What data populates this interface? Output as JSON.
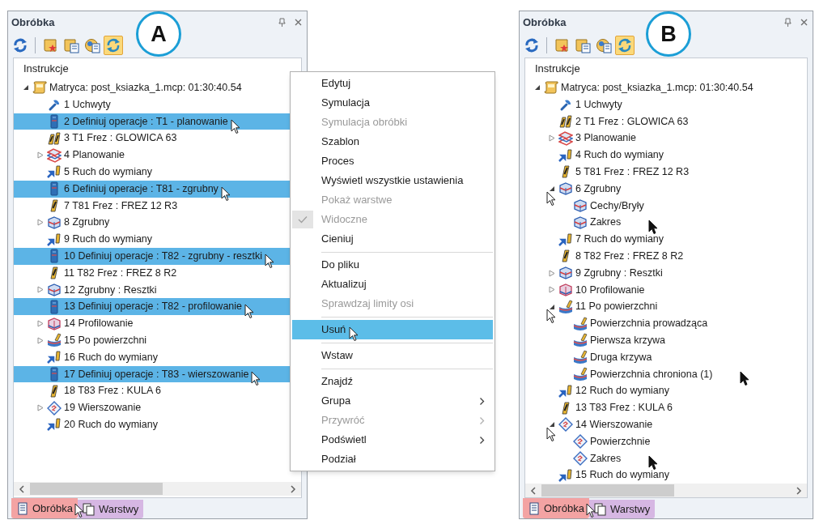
{
  "panels": [
    {
      "annotation": "A",
      "title": "Obróbka",
      "toolbar": [
        {
          "kind": "refresh",
          "selected": false
        },
        {
          "kind": "separator"
        },
        {
          "kind": "scrollstar",
          "selected": false
        },
        {
          "kind": "scrolldoc",
          "selected": false
        },
        {
          "kind": "discdoc",
          "selected": false
        },
        {
          "kind": "sync",
          "selected": true
        }
      ],
      "tree_header": "Instrukcje",
      "tree": [
        {
          "label": "Matryca: post_ksiazka_1.mcp: 01:30:40.54",
          "kind": "nc",
          "expanded": true,
          "selected": false,
          "children": [
            {
              "label": "1 Uchwyty",
              "kind": "fixture",
              "selected": false
            },
            {
              "label": "2 Definiuj operacje : T1 - planowanie",
              "kind": "define",
              "selected": true
            },
            {
              "label": "3 T1 Frez : GLOWICA 63",
              "kind": "facemill",
              "selected": false
            },
            {
              "label": "4 Planowanie",
              "kind": "planar",
              "expanded": false,
              "selected": false
            },
            {
              "label": "5 Ruch do wymiany",
              "kind": "move",
              "selected": false
            },
            {
              "label": "6 Definiuj operacje : T81 - zgrubny",
              "kind": "define",
              "selected": true
            },
            {
              "label": "7 T81 Frez : FREZ 12 R3",
              "kind": "tool",
              "selected": false
            },
            {
              "label": "8 Zgrubny",
              "kind": "rough",
              "expanded": false,
              "selected": false
            },
            {
              "label": "9 Ruch do wymiany",
              "kind": "move",
              "selected": false
            },
            {
              "label": "10 Definiuj operacje : T82 - zgrubny - resztki",
              "kind": "define",
              "selected": true
            },
            {
              "label": "11 T82 Frez : FREZ 8 R2",
              "kind": "tool",
              "selected": false
            },
            {
              "label": "12 Zgrubny : Resztki",
              "kind": "rough",
              "expanded": false,
              "selected": false
            },
            {
              "label": "13 Definiuj operacje : T82 - profilowanie",
              "kind": "define",
              "selected": true
            },
            {
              "label": "14 Profilowanie",
              "kind": "profile",
              "expanded": false,
              "selected": false
            },
            {
              "label": "15 Po powierzchni",
              "kind": "surface",
              "expanded": false,
              "selected": false
            },
            {
              "label": "16 Ruch do wymiany",
              "kind": "move",
              "selected": false
            },
            {
              "label": "17 Definiuj operacje : T83 - wierszowanie",
              "kind": "define",
              "selected": true
            },
            {
              "label": "18 T83 Frez : KULA 6",
              "kind": "tool",
              "selected": false
            },
            {
              "label": "19 Wierszowanie",
              "kind": "raster",
              "expanded": false,
              "selected": false
            },
            {
              "label": "20 Ruch do wymiany",
              "kind": "move",
              "selected": false
            }
          ]
        }
      ],
      "bottom_tabs": [
        {
          "label": "Obróbka",
          "kind": "document",
          "selected": true,
          "color": "#f3a3a3"
        },
        {
          "label": "Warstwy",
          "kind": "layers",
          "selected": false,
          "color": "#d6b7e3"
        }
      ]
    },
    {
      "annotation": "B",
      "title": "Obróbka",
      "toolbar": [
        {
          "kind": "refresh",
          "selected": false
        },
        {
          "kind": "separator"
        },
        {
          "kind": "scrollstar",
          "selected": false
        },
        {
          "kind": "scrolldoc",
          "selected": false
        },
        {
          "kind": "discdoc",
          "selected": false
        },
        {
          "kind": "sync",
          "selected": true
        }
      ],
      "tree_header": "Instrukcje",
      "tree": [
        {
          "label": "Matryca: post_ksiazka_1.mcp: 01:30:40.54",
          "kind": "nc",
          "expanded": true,
          "selected": false,
          "children": [
            {
              "label": "1 Uchwyty",
              "kind": "fixture",
              "selected": false
            },
            {
              "label": "2 T1 Frez : GLOWICA 63",
              "kind": "facemill",
              "selected": false
            },
            {
              "label": "3 Planowanie",
              "kind": "planar",
              "expanded": false,
              "selected": false
            },
            {
              "label": "4 Ruch do wymiany",
              "kind": "move",
              "selected": false
            },
            {
              "label": "5 T81 Frez : FREZ 12 R3",
              "kind": "tool",
              "selected": false
            },
            {
              "label": "6 Zgrubny",
              "kind": "rough",
              "expanded": true,
              "selected": false,
              "children": [
                {
                  "label": "Cechy/Bryły",
                  "kind": "rough",
                  "selected": false
                },
                {
                  "label": "Zakres",
                  "kind": "rough",
                  "selected": false
                }
              ]
            },
            {
              "label": "7 Ruch do wymiany",
              "kind": "move",
              "selected": false
            },
            {
              "label": "8 T82 Frez : FREZ 8 R2",
              "kind": "tool",
              "selected": false
            },
            {
              "label": "9 Zgrubny : Resztki",
              "kind": "rough",
              "expanded": false,
              "selected": false
            },
            {
              "label": "10 Profilowanie",
              "kind": "profile",
              "expanded": false,
              "selected": false
            },
            {
              "label": "11 Po powierzchni",
              "kind": "surface",
              "expanded": true,
              "selected": false,
              "children": [
                {
                  "label": "Powierzchnia prowadząca",
                  "kind": "surface",
                  "selected": false
                },
                {
                  "label": "Pierwsza krzywa",
                  "kind": "surface",
                  "selected": false
                },
                {
                  "label": "Druga krzywa",
                  "kind": "surface",
                  "selected": false
                },
                {
                  "label": "Powierzchnia chroniona (1)",
                  "kind": "surface",
                  "selected": false
                }
              ]
            },
            {
              "label": "12 Ruch do wymiany",
              "kind": "move",
              "selected": false
            },
            {
              "label": "13 T83 Frez : KULA 6",
              "kind": "tool",
              "selected": false
            },
            {
              "label": "14 Wierszowanie",
              "kind": "raster",
              "expanded": true,
              "selected": false,
              "children": [
                {
                  "label": "Powierzchnie",
                  "kind": "raster",
                  "selected": false
                },
                {
                  "label": "Zakres",
                  "kind": "raster",
                  "selected": false
                }
              ]
            },
            {
              "label": "15 Ruch do wymiany",
              "kind": "move",
              "selected": false
            }
          ]
        }
      ],
      "bottom_tabs": [
        {
          "label": "Obróbka",
          "kind": "document",
          "selected": true,
          "color": "#f3a3a3"
        },
        {
          "label": "Warstwy",
          "kind": "layers",
          "selected": false,
          "color": "#d6b7e3"
        }
      ]
    }
  ],
  "context_menu": {
    "items": [
      {
        "kind": "item",
        "label": "Edytuj",
        "disabled": false,
        "checked": false,
        "submenu": false,
        "selected": false
      },
      {
        "kind": "item",
        "label": "Symulacja",
        "disabled": false,
        "checked": false,
        "submenu": false,
        "selected": false
      },
      {
        "kind": "item",
        "label": "Symulacja obróbki",
        "disabled": true,
        "checked": false,
        "submenu": false,
        "selected": false
      },
      {
        "kind": "item",
        "label": "Szablon",
        "disabled": false,
        "checked": false,
        "submenu": false,
        "selected": false
      },
      {
        "kind": "item",
        "label": "Proces",
        "disabled": false,
        "checked": false,
        "submenu": false,
        "selected": false
      },
      {
        "kind": "item",
        "label": "Wyświetl wszystkie ustawienia",
        "disabled": false,
        "checked": false,
        "submenu": false,
        "selected": false
      },
      {
        "kind": "item",
        "label": "Pokaż warstwe",
        "disabled": true,
        "checked": false,
        "submenu": false,
        "selected": false
      },
      {
        "kind": "item",
        "label": "Widoczne",
        "disabled": true,
        "checked": true,
        "submenu": false,
        "selected": false
      },
      {
        "kind": "item",
        "label": "Cieniuj",
        "disabled": false,
        "checked": false,
        "submenu": false,
        "selected": false
      },
      {
        "kind": "separator"
      },
      {
        "kind": "item",
        "label": "Do pliku",
        "disabled": false,
        "checked": false,
        "submenu": false,
        "selected": false
      },
      {
        "kind": "item",
        "label": "Aktualizuj",
        "disabled": false,
        "checked": false,
        "submenu": false,
        "selected": false
      },
      {
        "kind": "item",
        "label": "Sprawdzaj limity osi",
        "disabled": true,
        "checked": false,
        "submenu": false,
        "selected": false
      },
      {
        "kind": "separator"
      },
      {
        "kind": "item",
        "label": "Usuń",
        "disabled": false,
        "checked": false,
        "submenu": false,
        "selected": true
      },
      {
        "kind": "separator"
      },
      {
        "kind": "item",
        "label": "Wstaw",
        "disabled": false,
        "checked": false,
        "submenu": false,
        "selected": false
      },
      {
        "kind": "separator"
      },
      {
        "kind": "item",
        "label": "Znajdź",
        "disabled": false,
        "checked": false,
        "submenu": false,
        "selected": false
      },
      {
        "kind": "item",
        "label": "Grupa",
        "disabled": false,
        "checked": false,
        "submenu": true,
        "selected": false
      },
      {
        "kind": "item",
        "label": "Przywróć",
        "disabled": true,
        "checked": false,
        "submenu": true,
        "selected": false
      },
      {
        "kind": "item",
        "label": "Podświetl",
        "disabled": false,
        "checked": false,
        "submenu": true,
        "selected": false
      },
      {
        "kind": "item",
        "label": "Podział",
        "disabled": false,
        "checked": false,
        "submenu": false,
        "selected": false
      }
    ]
  }
}
